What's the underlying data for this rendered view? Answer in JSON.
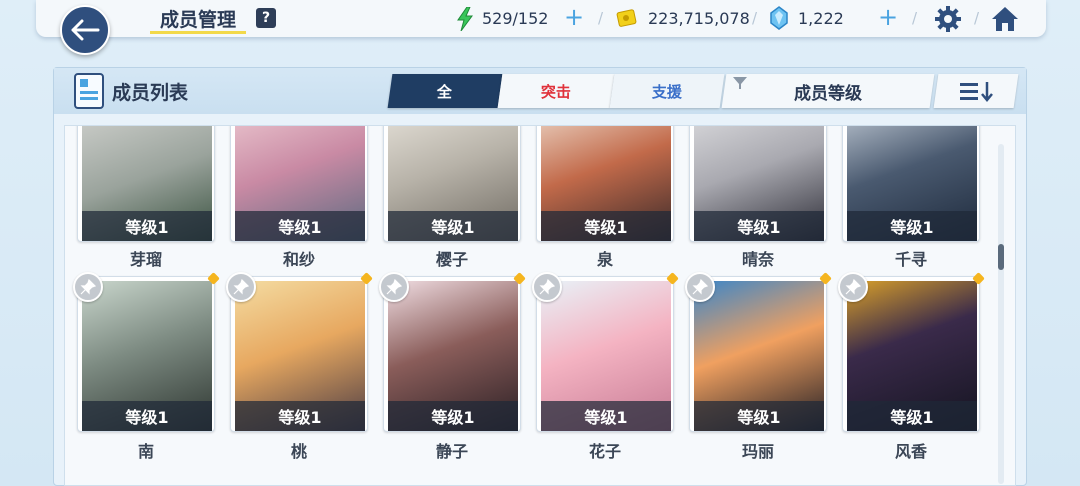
{
  "header": {
    "title": "成员管理",
    "help_label": "?",
    "ap": "529/152",
    "credits": "223,715,078",
    "pyroxene": "1,222",
    "plus_label": "+",
    "separator": "/"
  },
  "panel": {
    "title": "成员列表",
    "tabs": [
      {
        "label": "全",
        "active": true
      },
      {
        "label": "突击",
        "color": "#e0323b"
      },
      {
        "label": "支援",
        "color": "#3a6fc9"
      }
    ],
    "sort_label": "成员等级"
  },
  "colors": {
    "primary_dark": "#1f3d63",
    "attack_red": "#e0323b",
    "support_blue": "#3a6fc9",
    "ap_green": "#39c65a",
    "credit_yellow": "#f2d01a",
    "pyroxene_blue": "#4aa3e0",
    "favorite_gold": "#f5b51f"
  },
  "characters_row1": [
    {
      "name": "芽瑠",
      "level": "等级1"
    },
    {
      "name": "和纱",
      "level": "等级1"
    },
    {
      "name": "樱子",
      "level": "等级1"
    },
    {
      "name": "泉",
      "level": "等级1"
    },
    {
      "name": "晴奈",
      "level": "等级1"
    },
    {
      "name": "千寻",
      "level": "等级1"
    }
  ],
  "characters_row2": [
    {
      "name": "南",
      "level": "等级1"
    },
    {
      "name": "桃",
      "level": "等级1"
    },
    {
      "name": "静子",
      "level": "等级1"
    },
    {
      "name": "花子",
      "level": "等级1"
    },
    {
      "name": "玛丽",
      "level": "等级1"
    },
    {
      "name": "风香",
      "level": "等级1"
    }
  ]
}
